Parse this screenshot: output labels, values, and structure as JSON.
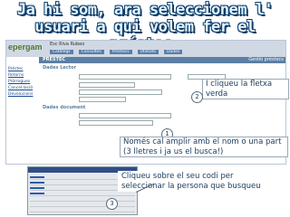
{
  "title": {
    "line1": "Ja hi som, ara seleccionem l'",
    "line2": "usuari a qui volem fer el préstec."
  },
  "app": {
    "logo": "epergam",
    "user": "Esc Riva Rubeo",
    "menu": [
      "Catàlegs",
      "Consultes",
      "Préstecs",
      "Utilitats",
      "Dades"
    ],
    "section": "PRÉSTEC",
    "section_right": "Gestió préstecs",
    "nav": [
      "Préstec",
      "Retorns",
      "Pròrrogues",
      "Cancel·lació",
      "Devolucions"
    ],
    "sub_reader": "Dades Lector",
    "sub_document": "Dades document"
  },
  "annotations": {
    "click_arrow": "I cliqueu la fletxa verda",
    "expand_name": "Només cal amplir amb el nom o una part (3 lletres i ja us el busca!)",
    "click_code": "Cliqueu sobre el seu codi per seleccionar la persona que busqueu",
    "step1": "1",
    "step2": "2",
    "step3": "3"
  },
  "colors": {
    "title_fill": "#e2f3ff",
    "title_outline": "#0f3d69",
    "header_bar": "#5c7fa3",
    "link_blue": "#1a4a8a"
  }
}
